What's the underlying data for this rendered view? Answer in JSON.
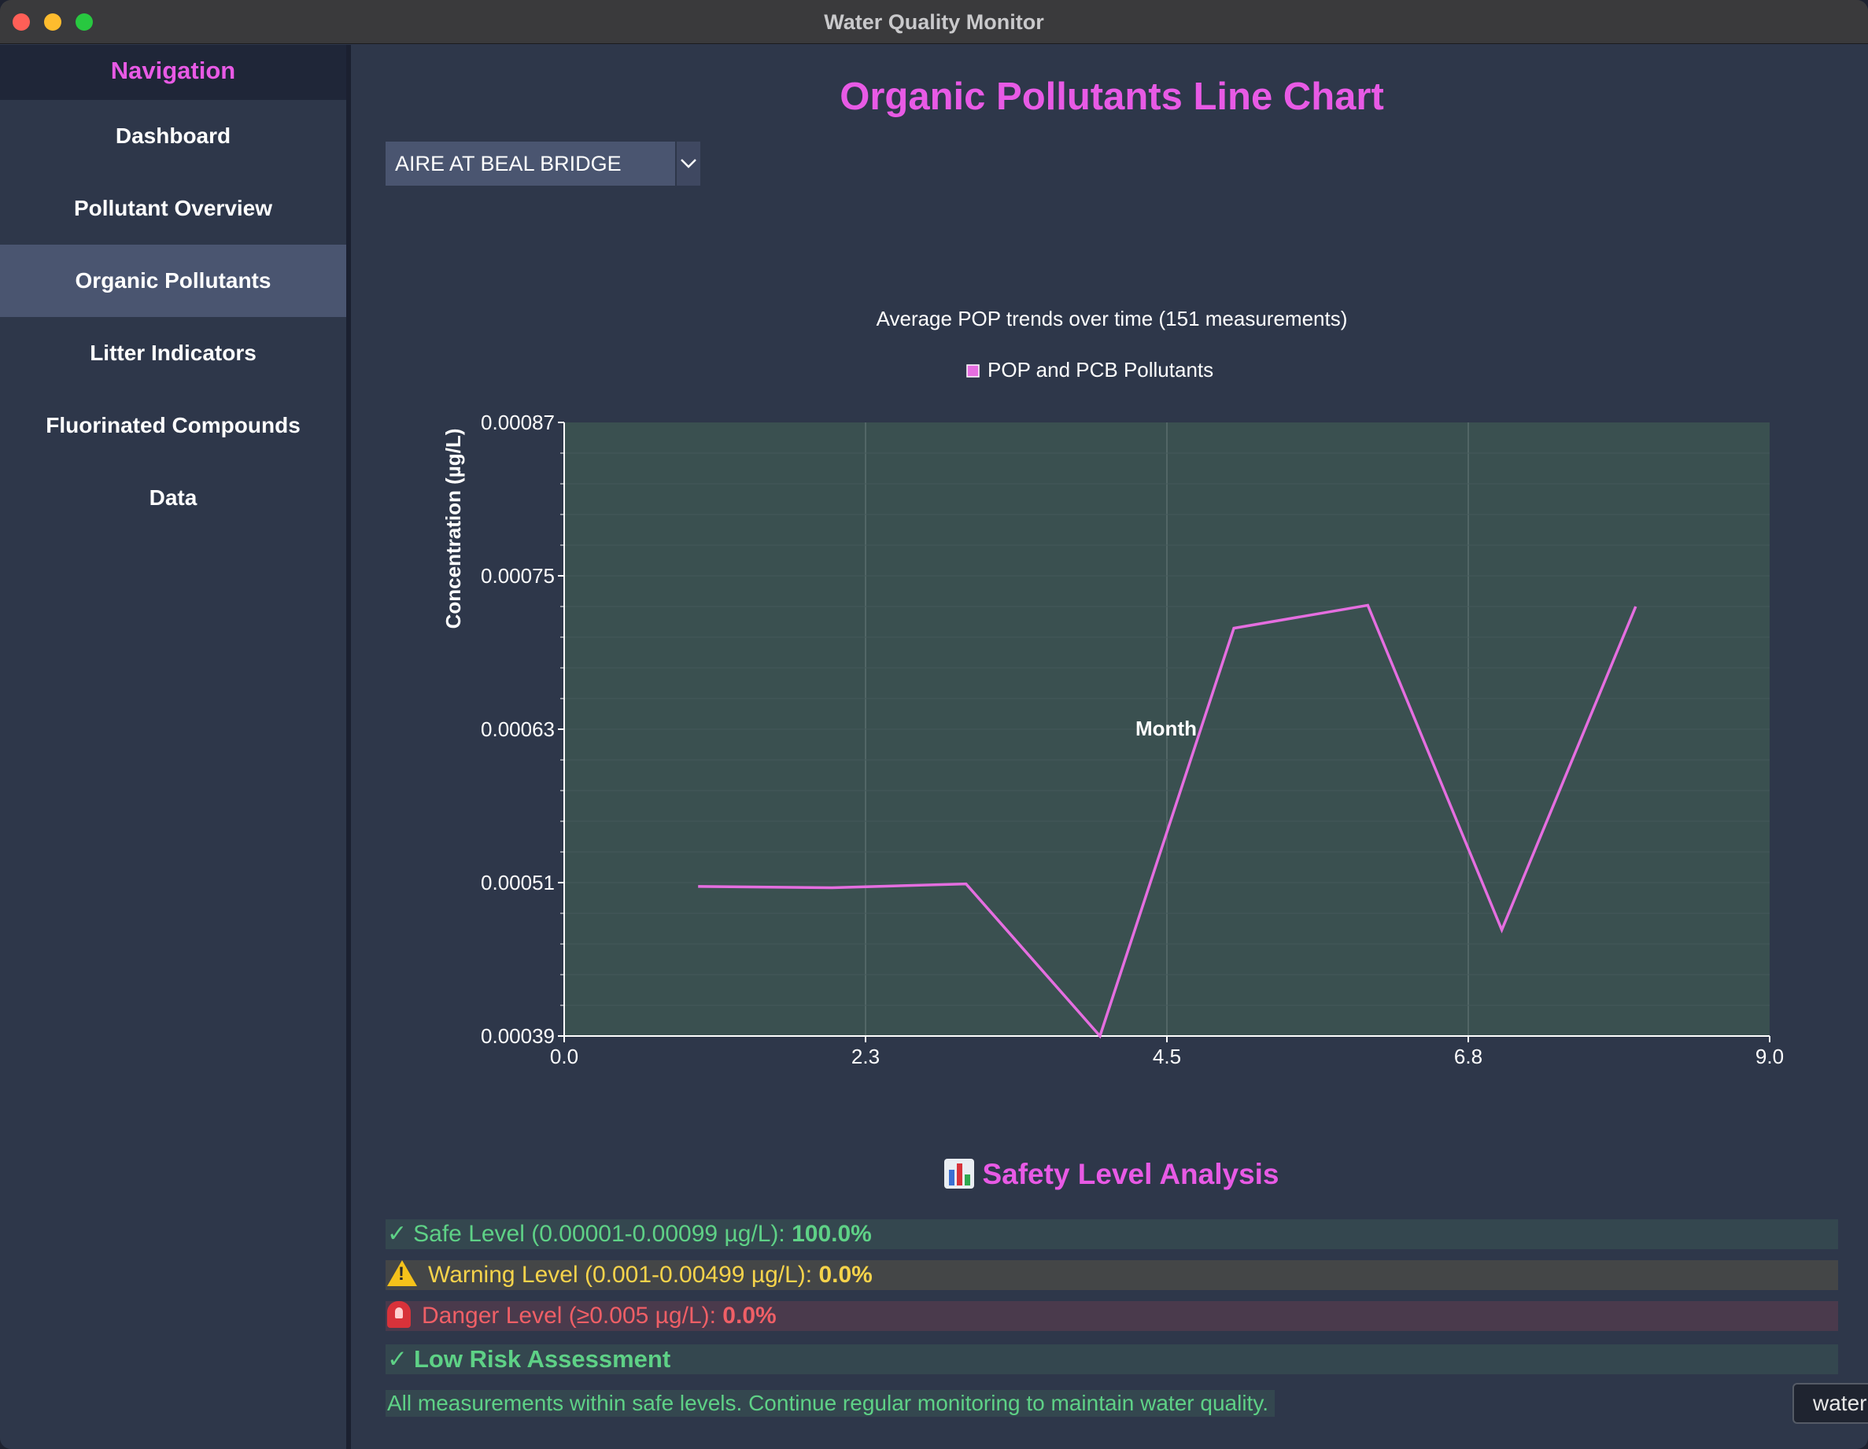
{
  "window": {
    "title": "Water Quality Monitor"
  },
  "sidebar": {
    "header": "Navigation",
    "items": [
      {
        "label": "Dashboard",
        "active": false
      },
      {
        "label": "Pollutant Overview",
        "active": false
      },
      {
        "label": "Organic Pollutants",
        "active": true
      },
      {
        "label": "Litter Indicators",
        "active": false
      },
      {
        "label": "Fluorinated Compounds",
        "active": false
      },
      {
        "label": "Data",
        "active": false
      }
    ]
  },
  "main": {
    "title": "Organic Pollutants Line Chart",
    "location_select": {
      "value": "AIRE AT BEAL BRIDGE"
    }
  },
  "chart_data": {
    "type": "line",
    "title": "Average POP trends over time (151 measurements)",
    "xlabel": "Month",
    "ylabel": "Concentration (µg/L)",
    "xlim": [
      0,
      9
    ],
    "ylim": [
      0.00039,
      0.00087
    ],
    "x_ticks": [
      "0.0",
      "2.3",
      "4.5",
      "6.8",
      "9.0"
    ],
    "y_ticks": [
      "0.00087",
      "0.00075",
      "0.00063",
      "0.00051",
      "0.00039"
    ],
    "legend_position": "top",
    "grid": true,
    "series": [
      {
        "name": "POP and PCB Pollutants",
        "color": "#e56ee0",
        "x": [
          1,
          2,
          3,
          4,
          5,
          6,
          7,
          8
        ],
        "y": [
          0.000507,
          0.000506,
          0.000509,
          0.00039,
          0.000709,
          0.000727,
          0.000473,
          0.000726
        ]
      }
    ]
  },
  "safety": {
    "heading": "Safety Level Analysis",
    "heading_icon": "bar-chart-icon",
    "safe": {
      "icon": "check-icon",
      "glyph": "✓",
      "label": "Safe Level (0.00001-0.00099 µg/L): ",
      "value": "100.0%"
    },
    "warning": {
      "icon": "warning-icon",
      "label": "Warning Level (0.001-0.00499 µg/L): ",
      "value": "0.0%"
    },
    "danger": {
      "icon": "siren-icon",
      "label": "Danger Level (≥0.005 µg/L): ",
      "value": "0.0%"
    },
    "risk": {
      "icon": "check-icon",
      "glyph": "✓",
      "label": "Low Risk Assessment"
    },
    "message": "All measurements within safe levels. Continue regular monitoring to maintain water quality."
  },
  "tooltip": {
    "text": "water"
  },
  "colors": {
    "accent": "#e85ae5",
    "safe": "#5ed186",
    "warning": "#f6d34b",
    "danger": "#ef5f66"
  }
}
